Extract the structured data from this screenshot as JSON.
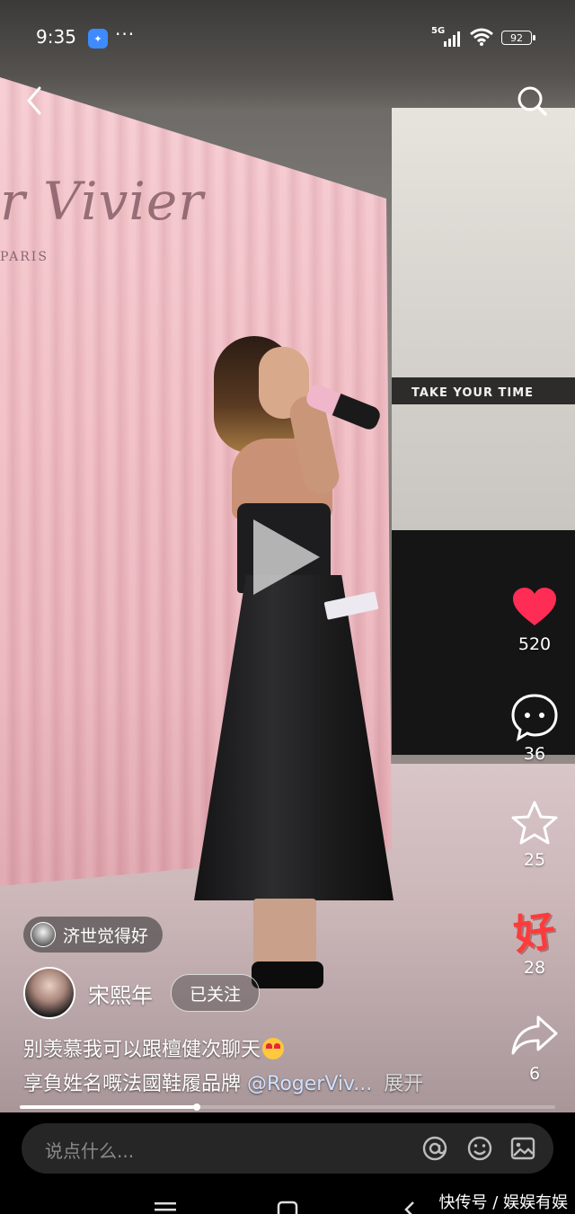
{
  "status_bar": {
    "time": "9:35",
    "app_badge_icon": "app-notification-icon",
    "more": "···",
    "network": "5G",
    "battery": "92"
  },
  "top_nav": {
    "back_icon": "chevron-left-icon",
    "search_icon": "search-icon"
  },
  "video": {
    "background_sign": "TAKE YOUR TIME",
    "brand_text": "r Vivier",
    "brand_sub": "PARIS",
    "paused": true,
    "progress_fraction": 0.33
  },
  "actions": {
    "like": {
      "icon": "heart-icon",
      "count": "520",
      "color": "#ff2d55",
      "active": true
    },
    "comment": {
      "icon": "comment-bubble-icon",
      "count": "36"
    },
    "favorite": {
      "icon": "star-icon",
      "count": "25"
    },
    "hao": {
      "label": "好",
      "count": "28",
      "color": "#ff3a3a"
    },
    "share": {
      "icon": "share-arrow-icon",
      "count": "6"
    }
  },
  "post": {
    "tag_user": "济世觉得好",
    "author": "宋熙年",
    "follow_label": "已关注",
    "caption_line1": "别羡慕我可以跟檀健次聊天",
    "caption_line2": "享負姓名嘅法國鞋履品牌",
    "mention": "@RogerViv...",
    "expand": "展开"
  },
  "comment_bar": {
    "placeholder": "说点什么...",
    "icons": [
      "at-icon",
      "emoji-icon",
      "image-icon"
    ]
  },
  "watermark": "快传号 / 娱娱有娱"
}
